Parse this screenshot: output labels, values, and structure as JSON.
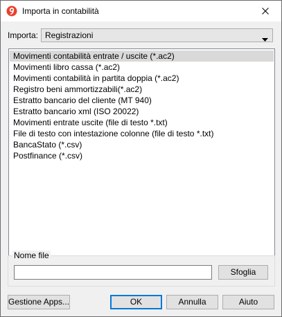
{
  "window": {
    "title": "Importa in contabilità",
    "accent_color": "#e8412d"
  },
  "import": {
    "label": "Importa:",
    "selected": "Registrazioni"
  },
  "list": {
    "items": [
      "Movimenti contabilità entrate / uscite (*.ac2)",
      "Movimenti libro cassa (*.ac2)",
      "Movimenti contabilità in partita doppia (*.ac2)",
      "Registro beni ammortizzabili(*.ac2)",
      "Estratto bancario del cliente (MT 940)",
      "Estratto bancario xml (ISO 20022)",
      "Movimenti entrate uscite (file di testo *.txt)",
      "File di testo con intestazione colonne (file di testo *.txt)",
      "BancaStato (*.csv)",
      "Postfinance (*.csv)"
    ],
    "selected_index": 0
  },
  "file": {
    "group_label": "Nome file",
    "value": "",
    "browse_label": "Sfoglia"
  },
  "buttons": {
    "apps": "Gestione Apps...",
    "ok": "OK",
    "cancel": "Annulla",
    "help": "Aiuto"
  }
}
